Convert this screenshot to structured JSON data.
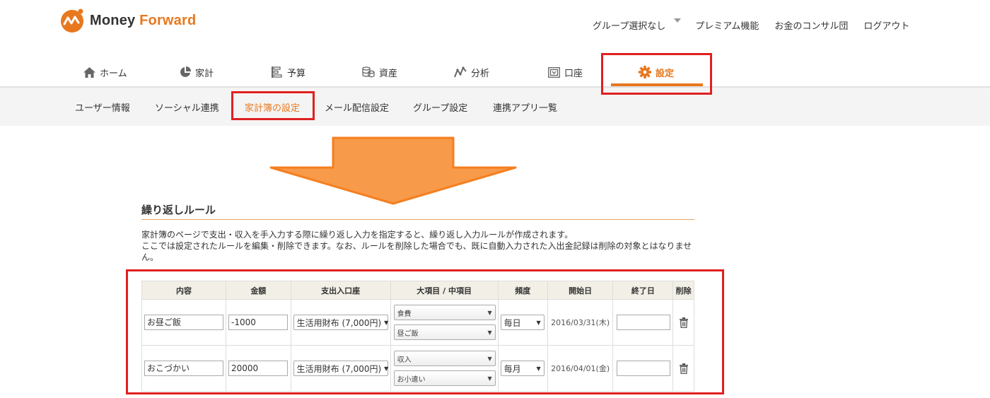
{
  "logo": {
    "word1": "Money",
    "word2": "Forward"
  },
  "topnav": {
    "group": "グループ選択なし",
    "premium": "プレミアム機能",
    "consult": "お金のコンサル団",
    "logout": "ログアウト"
  },
  "mainnav": [
    {
      "label": "ホーム",
      "icon": "home-icon"
    },
    {
      "label": "家計",
      "icon": "pie-chart-icon"
    },
    {
      "label": "予算",
      "icon": "budget-icon"
    },
    {
      "label": "資産",
      "icon": "coins-icon"
    },
    {
      "label": "分析",
      "icon": "line-chart-icon"
    },
    {
      "label": "口座",
      "icon": "account-icon"
    },
    {
      "label": "設定",
      "icon": "gear-icon"
    }
  ],
  "subnav": [
    "ユーザー情報",
    "ソーシャル連携",
    "家計簿の設定",
    "メール配信設定",
    "グループ設定",
    "連携アプリ一覧"
  ],
  "section": {
    "title": "繰り返しルール",
    "desc1": "家計簿のページで支出・収入を手入力する際に繰り返し入力を指定すると、繰り返し入力ルールが作成されます。",
    "desc2": "ここでは設定されたルールを編集・削除できます。なお、ルールを削除した場合でも、既に自動入力された入出金記録は削除の対象とはなりません。"
  },
  "table": {
    "headers": [
      "内容",
      "金額",
      "支出入口座",
      "大項目 / 中項目",
      "頻度",
      "開始日",
      "終了日",
      "削除"
    ],
    "rows": [
      {
        "content": "お昼ご飯",
        "amount": "-1000",
        "account": "生活用財布 (7,000円)",
        "large": "食費",
        "middle": "昼ご飯",
        "freq": "毎日",
        "start": "2016/03/31(木)",
        "end": ""
      },
      {
        "content": "おこづかい",
        "amount": "20000",
        "account": "生活用財布 (7,000円)",
        "large": "収入",
        "middle": "お小遣い",
        "freq": "毎月",
        "start": "2016/04/01(金)",
        "end": ""
      }
    ]
  },
  "colors": {
    "accent": "#e8781e",
    "highlight": "#e02020",
    "arrow": "#f79a4a"
  }
}
